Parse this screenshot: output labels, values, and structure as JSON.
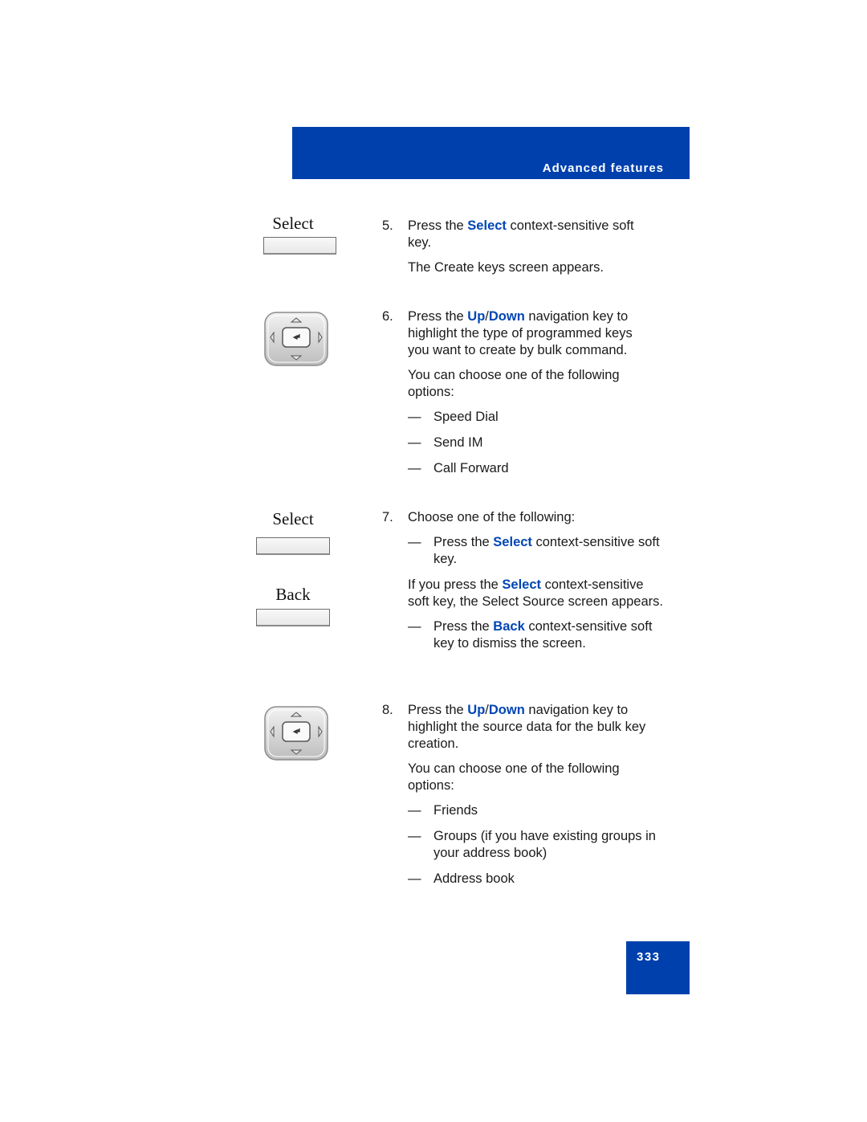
{
  "header": {
    "section_title": "Advanced features"
  },
  "footer": {
    "page_number": "333"
  },
  "colors": {
    "brand_blue": "#0040ad",
    "highlight_blue": "#0046b4"
  },
  "left_graphics": {
    "softkey_select_1": "Select",
    "softkey_select_2": "Select",
    "softkey_back": "Back"
  },
  "steps": [
    {
      "number": "5.",
      "line1_pre": "Press the ",
      "line1_hl": "Select",
      "line1_post": " context-sensitive soft key.",
      "note": "The Create keys screen appears."
    },
    {
      "number": "6.",
      "line1_pre": "Press the ",
      "line1_hl": "Up",
      "line1_sep": "/",
      "line1_hl2": "Down",
      "line1_post": " navigation key to highlight the type of programmed keys you want to create by bulk command.",
      "note": "You can choose one of the following options:",
      "options": [
        "Speed Dial",
        "Send IM",
        "Call Forward"
      ]
    },
    {
      "number": "7.",
      "intro": "Choose one of the following:",
      "opt1_pre": "Press the ",
      "opt1_hl": "Select",
      "opt1_post": " context-sensitive soft key.",
      "note_pre": "If you press the ",
      "note_hl": "Select",
      "note_post": " context-sensitive soft key, the Select Source screen appears.",
      "opt2_pre": "Press the ",
      "opt2_hl": "Back",
      "opt2_post": " context-sensitive soft key to dismiss the screen."
    },
    {
      "number": "8.",
      "line1_pre": "Press the ",
      "line1_hl": "Up",
      "line1_sep": "/",
      "line1_hl2": "Down",
      "line1_post": " navigation key to highlight the source data for the bulk key creation.",
      "note": "You can choose one of the following options:",
      "options": [
        "Friends",
        "Groups (if you have existing groups in your address book)",
        "Address book"
      ]
    }
  ],
  "dash_glyph": "—"
}
